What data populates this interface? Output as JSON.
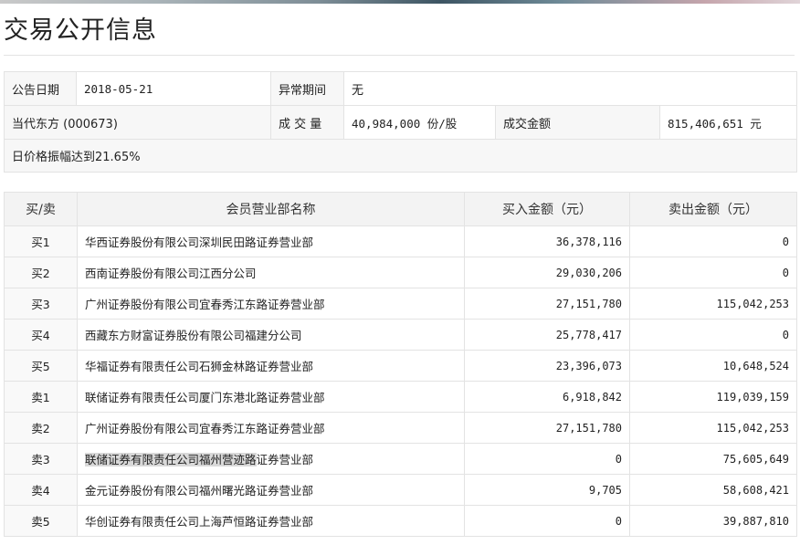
{
  "title": "交易公开信息",
  "info": {
    "announce_date_label": "公告日期",
    "announce_date": "2018-05-21",
    "abnormal_period_label": "异常期间",
    "abnormal_period": "无",
    "stock": "当代东方 (000673)",
    "volume_label": "成 交 量",
    "volume": "40,984,000 份/股",
    "amount_label": "成交金额",
    "amount": "815,406,651 元",
    "amplitude": "日价格振幅达到21.65%"
  },
  "table": {
    "headers": [
      "买/卖",
      "会员营业部名称",
      "买入金额（元）",
      "卖出金额（元）"
    ],
    "rows": [
      {
        "side": "买1",
        "name": "华西证券股份有限公司深圳民田路证券营业部",
        "buy": "36,378,116",
        "sell": "0"
      },
      {
        "side": "买2",
        "name": "西南证券股份有限公司江西分公司",
        "buy": "29,030,206",
        "sell": "0"
      },
      {
        "side": "买3",
        "name": "广州证券股份有限公司宜春秀江东路证券营业部",
        "buy": "27,151,780",
        "sell": "115,042,253"
      },
      {
        "side": "买4",
        "name": "西藏东方财富证券股份有限公司福建分公司",
        "buy": "25,778,417",
        "sell": "0"
      },
      {
        "side": "买5",
        "name": "华福证券有限责任公司石狮金林路证券营业部",
        "buy": "23,396,073",
        "sell": "10,648,524"
      },
      {
        "side": "卖1",
        "name": "联储证券有限责任公司厦门东港北路证券营业部",
        "buy": "6,918,842",
        "sell": "119,039,159"
      },
      {
        "side": "卖2",
        "name": "广州证券股份有限公司宜春秀江东路证券营业部",
        "buy": "27,151,780",
        "sell": "115,042,253"
      },
      {
        "side": "卖3",
        "name_highlight": "联储证券有限责任公司福州营迹路",
        "name_rest": "证券营业部",
        "buy": "0",
        "sell": "75,605,649"
      },
      {
        "side": "卖4",
        "name": "金元证券股份有限公司福州曙光路证券营业部",
        "buy": "9,705",
        "sell": "58,608,421"
      },
      {
        "side": "卖5",
        "name": "华创证券有限责任公司上海芦恒路证券营业部",
        "buy": "0",
        "sell": "39,887,810"
      }
    ]
  }
}
